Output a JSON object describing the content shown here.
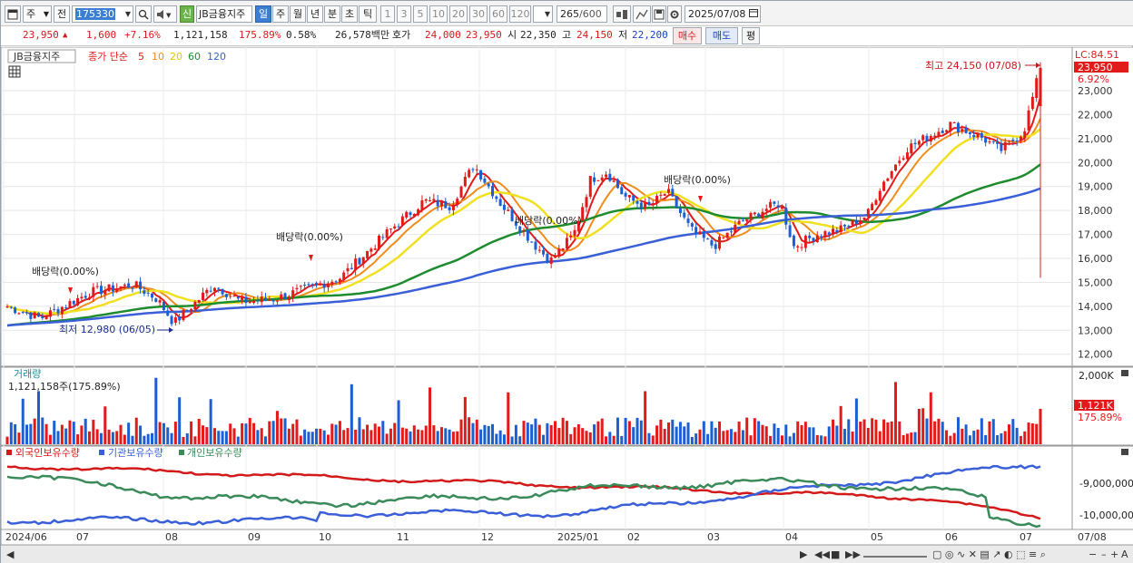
{
  "toolbar": {
    "market_label": "주",
    "prev_label": "전",
    "stock_code": "175330",
    "stock_name": "JB금융지주",
    "credit_badge": "신",
    "periods": [
      "일",
      "주",
      "월",
      "년",
      "분",
      "초",
      "틱"
    ],
    "period_active": "일",
    "minute_steps": [
      "1",
      "3",
      "5",
      "10",
      "20",
      "30",
      "60",
      "120"
    ],
    "count_value": "265",
    "count_total": "/600",
    "date_value": "2025/07/08"
  },
  "quote": {
    "price": "23,950",
    "change": "1,600",
    "change_rate": "+7.16%",
    "volume": "1,121,158",
    "volume_ratio": "175.89%",
    "turnover": "0.58%",
    "amount": "26,578백만",
    "ask_label": "호가",
    "ask": "24,000",
    "bid": "23,950",
    "open_label": "시",
    "open": "22,350",
    "high_label": "고",
    "high": "24,150",
    "low_label": "저",
    "low": "22,200",
    "buy_button": "매수",
    "sell_button": "매도",
    "eval_button": "평"
  },
  "colors": {
    "up": "#e21a1a",
    "down": "#1c5fd2",
    "ma5": "#e21a1a",
    "ma10": "#f08c1c",
    "ma20": "#f0e020",
    "ma60": "#1e8c2e",
    "ma120": "#3a5fd6",
    "foreign": "#d21a1a",
    "institution": "#3a5fd6",
    "individual": "#3a8a5a"
  },
  "price_panel": {
    "legend_name": "JB금융지주",
    "legend_series": "종가 단순",
    "ma_periods": [
      "5",
      "10",
      "20",
      "60",
      "120"
    ],
    "lc_label": "LC:84.51",
    "last_price_tag": "23,950",
    "last_change_tag": "6.92%",
    "y_ticks": [
      "23,000",
      "22,000",
      "21,000",
      "20,000",
      "19,000",
      "18,000",
      "17,000",
      "16,000",
      "15,000",
      "14,000",
      "13,000",
      "12,000"
    ],
    "annotations": {
      "high": "최고 24,150 (07/08)",
      "low": "최저 12,980 (06/05)",
      "dividend_1": "배당락(0.00%)",
      "dividend_2": "배당락(0.00%)",
      "dividend_3": "배당락(0.00%)",
      "dividend_4": "배당락(0.00%)"
    }
  },
  "volume_panel": {
    "title": "거래량",
    "value_text": "1,121,158주(175.89%)",
    "axis_label": "2,000K",
    "last_tag": "1,121K",
    "last_pct": "175.89%"
  },
  "holding_panel": {
    "legend": [
      "외국인보유수량",
      "기관보유수량",
      "개인보유수량"
    ],
    "y_ticks": [
      "-9,000,000",
      "-10,000,000"
    ]
  },
  "x_axis": [
    "2024/06",
    "07",
    "08",
    "09",
    "10",
    "11",
    "12",
    "2025/01",
    "02",
    "03",
    "04",
    "05",
    "06",
    "07",
    "07/08"
  ]
}
